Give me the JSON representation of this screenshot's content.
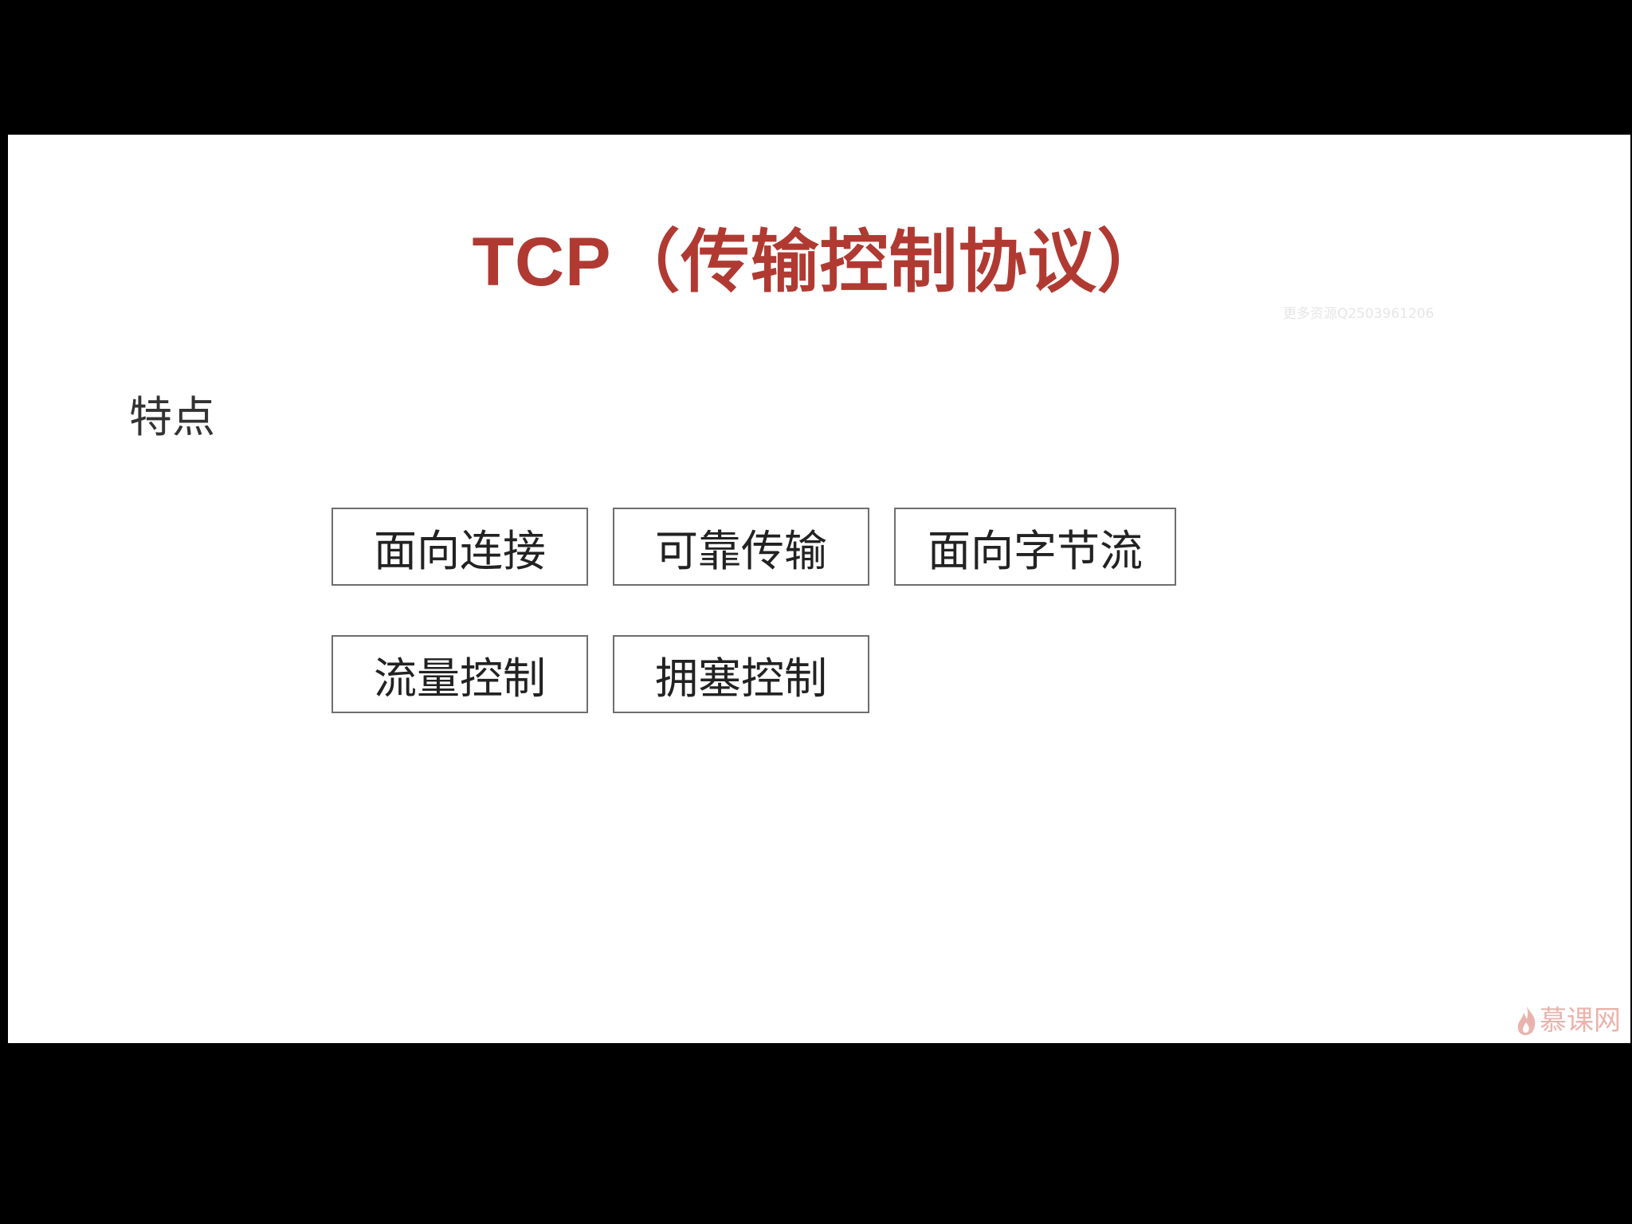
{
  "slide": {
    "title": "TCP（传输控制协议）",
    "watermark": "更多资源Q2503961206",
    "section_label": "特点",
    "features": [
      "面向连接",
      "可靠传输",
      "面向字节流",
      "流量控制",
      "拥塞控制"
    ],
    "brand": {
      "text": "慕课网",
      "icon": "flame-icon"
    }
  },
  "colors": {
    "background": "#000000",
    "slide_background": "#ffffff",
    "title": "#b03a32",
    "box_border": "#6e6e6e",
    "text": "#222222",
    "brand": "#e9b3ad"
  }
}
